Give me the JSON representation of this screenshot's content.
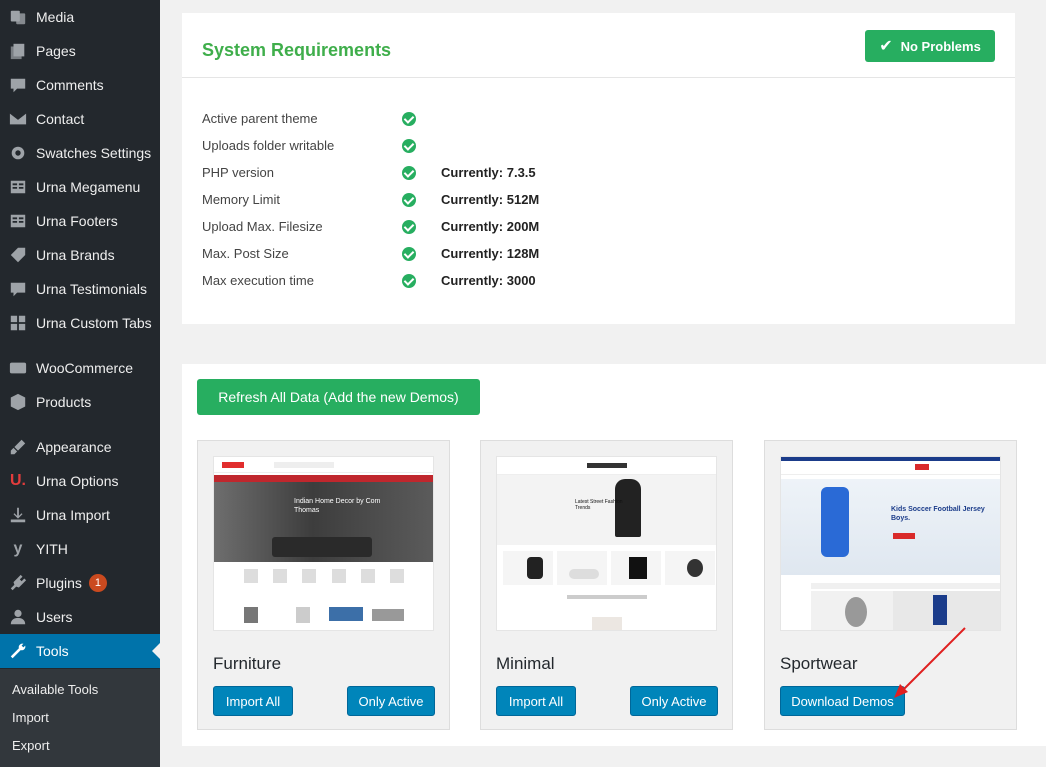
{
  "sidebar": {
    "items": [
      {
        "label": "Media",
        "icon": "media-icon"
      },
      {
        "label": "Pages",
        "icon": "pages-icon"
      },
      {
        "label": "Comments",
        "icon": "comments-icon"
      },
      {
        "label": "Contact",
        "icon": "mail-icon"
      },
      {
        "label": "Swatches Settings",
        "icon": "gear-icon"
      },
      {
        "label": "Urna Megamenu",
        "icon": "grid-icon"
      },
      {
        "label": "Urna Footers",
        "icon": "grid-icon"
      },
      {
        "label": "Urna Brands",
        "icon": "tag-icon"
      },
      {
        "label": "Urna Testimonials",
        "icon": "quote-icon"
      },
      {
        "label": "Urna Custom Tabs",
        "icon": "tabs-icon"
      },
      {
        "label": "WooCommerce",
        "icon": "woocommerce-icon"
      },
      {
        "label": "Products",
        "icon": "box-icon"
      },
      {
        "label": "Appearance",
        "icon": "paintbrush-icon"
      },
      {
        "label": "Urna Options",
        "icon": "urna-logo-icon"
      },
      {
        "label": "Urna Import",
        "icon": "download-icon"
      },
      {
        "label": "YITH",
        "icon": "yith-icon"
      },
      {
        "label": "Plugins",
        "icon": "plugin-icon",
        "badge": "1"
      },
      {
        "label": "Users",
        "icon": "user-icon"
      },
      {
        "label": "Tools",
        "icon": "wrench-icon",
        "active": true
      }
    ],
    "submenu": [
      "Available Tools",
      "Import",
      "Export"
    ]
  },
  "requirements": {
    "title": "System Requirements",
    "status_button": "No Problems",
    "rows": [
      {
        "label": "Active parent theme",
        "value": ""
      },
      {
        "label": "Uploads folder writable",
        "value": ""
      },
      {
        "label": "PHP version",
        "value": "Currently: 7.3.5"
      },
      {
        "label": "Memory Limit",
        "value": "Currently: 512M"
      },
      {
        "label": "Upload Max. Filesize",
        "value": "Currently: 200M"
      },
      {
        "label": "Max. Post Size",
        "value": "Currently: 128M"
      },
      {
        "label": "Max execution time",
        "value": "Currently: 3000"
      }
    ]
  },
  "demos": {
    "refresh_button": "Refresh All Data (Add the new Demos)",
    "cards": [
      {
        "name": "Furniture",
        "thumb_text": "Indian Home Decor by Com Thomas",
        "buttons": [
          "Import All",
          "Only Active"
        ]
      },
      {
        "name": "Minimal",
        "thumb_text": "Latest Street Fashion Trends",
        "buttons": [
          "Import All",
          "Only Active"
        ]
      },
      {
        "name": "Sportwear",
        "thumb_text": "Kids Soccer Football Jersey Boys.",
        "buttons": [
          "Download Demos"
        ]
      }
    ]
  },
  "colors": {
    "success": "#27ae60",
    "title_green": "#3fae4b",
    "wp_blue": "#0085ba",
    "sidebar_bg": "#23282d",
    "arrow_red": "#e02020"
  }
}
